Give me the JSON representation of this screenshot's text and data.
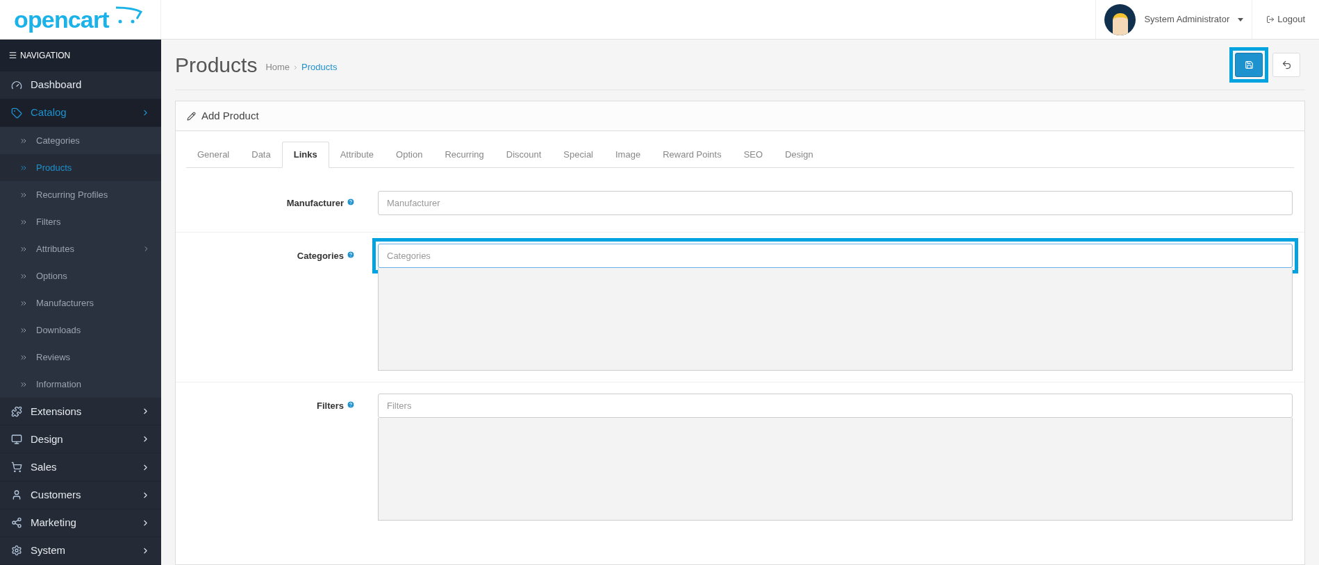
{
  "header": {
    "logo": "opencart",
    "user": "System Administrator",
    "logout": "Logout"
  },
  "sidebar": {
    "title": "NAVIGATION",
    "items": [
      {
        "label": "Dashboard",
        "selected": false,
        "has_arrow": false
      },
      {
        "label": "Catalog",
        "selected": true,
        "has_arrow": true,
        "expanded": true,
        "children": [
          {
            "label": "Categories",
            "selected": false,
            "has_arrow": false
          },
          {
            "label": "Products",
            "selected": true,
            "has_arrow": false
          },
          {
            "label": "Recurring Profiles",
            "selected": false,
            "has_arrow": false
          },
          {
            "label": "Filters",
            "selected": false,
            "has_arrow": false
          },
          {
            "label": "Attributes",
            "selected": false,
            "has_arrow": true
          },
          {
            "label": "Options",
            "selected": false,
            "has_arrow": false
          },
          {
            "label": "Manufacturers",
            "selected": false,
            "has_arrow": false
          },
          {
            "label": "Downloads",
            "selected": false,
            "has_arrow": false
          },
          {
            "label": "Reviews",
            "selected": false,
            "has_arrow": false
          },
          {
            "label": "Information",
            "selected": false,
            "has_arrow": false
          }
        ]
      },
      {
        "label": "Extensions",
        "selected": false,
        "has_arrow": true
      },
      {
        "label": "Design",
        "selected": false,
        "has_arrow": true
      },
      {
        "label": "Sales",
        "selected": false,
        "has_arrow": true
      },
      {
        "label": "Customers",
        "selected": false,
        "has_arrow": true
      },
      {
        "label": "Marketing",
        "selected": false,
        "has_arrow": true
      },
      {
        "label": "System",
        "selected": false,
        "has_arrow": true
      }
    ]
  },
  "page": {
    "title": "Products",
    "breadcrumb": [
      {
        "label": "Home",
        "current": false
      },
      {
        "label": "Products",
        "current": true
      }
    ],
    "save_button": {
      "highlighted": true
    }
  },
  "panel": {
    "title": "Add Product",
    "tabs": [
      {
        "label": "General",
        "selected": false
      },
      {
        "label": "Data",
        "selected": false
      },
      {
        "label": "Links",
        "selected": true
      },
      {
        "label": "Attribute",
        "selected": false
      },
      {
        "label": "Option",
        "selected": false
      },
      {
        "label": "Recurring",
        "selected": false
      },
      {
        "label": "Discount",
        "selected": false
      },
      {
        "label": "Special",
        "selected": false
      },
      {
        "label": "Image",
        "selected": false
      },
      {
        "label": "Reward Points",
        "selected": false
      },
      {
        "label": "SEO",
        "selected": false
      },
      {
        "label": "Design",
        "selected": false
      }
    ],
    "fields": [
      {
        "label": "Manufacturer",
        "placeholder": "Manufacturer",
        "has_list": false,
        "highlighted": false,
        "focused": false
      },
      {
        "label": "Categories",
        "placeholder": "Categories",
        "has_list": true,
        "highlighted": true,
        "focused": true
      },
      {
        "label": "Filters",
        "placeholder": "Filters",
        "has_list": true,
        "highlighted": false,
        "focused": false
      }
    ]
  }
}
